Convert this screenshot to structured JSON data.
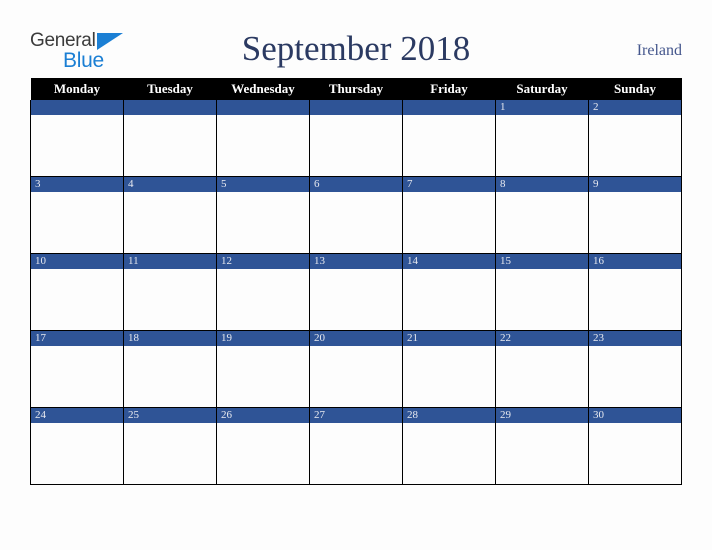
{
  "brand": {
    "name_part1": "General",
    "name_part2": "Blue",
    "triangle_color": "#1b7fd4",
    "text_color": "#3b3b3b"
  },
  "header": {
    "title": "September 2018",
    "country": "Ireland",
    "title_color": "#2b3a62",
    "country_color": "#44568c"
  },
  "calendar": {
    "weekday_headers": [
      "Monday",
      "Tuesday",
      "Wednesday",
      "Thursday",
      "Friday",
      "Saturday",
      "Sunday"
    ],
    "header_bg": "#000000",
    "header_fg": "#ffffff",
    "date_bar_bg": "#2f5496",
    "date_bar_fg": "#e8eaf0",
    "cell_bg": "#fdfdfd",
    "grid_line": "#000000",
    "weeks": [
      [
        "",
        "",
        "",
        "",
        "",
        "1",
        "2"
      ],
      [
        "3",
        "4",
        "5",
        "6",
        "7",
        "8",
        "9"
      ],
      [
        "10",
        "11",
        "12",
        "13",
        "14",
        "15",
        "16"
      ],
      [
        "17",
        "18",
        "19",
        "20",
        "21",
        "22",
        "23"
      ],
      [
        "24",
        "25",
        "26",
        "27",
        "28",
        "29",
        "30"
      ]
    ]
  }
}
